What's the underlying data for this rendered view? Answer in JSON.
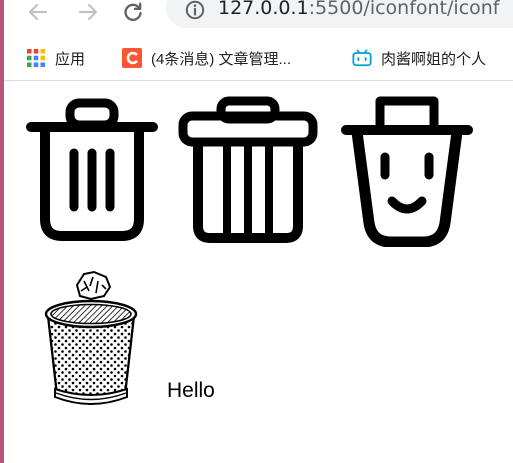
{
  "browser": {
    "url_host": "127.0.0.1",
    "url_rest": ":5500/iconfont/iconf",
    "nav": {
      "back_icon": "arrow-left-icon",
      "forward_icon": "arrow-right-icon",
      "reload_icon": "reload-icon",
      "site_info_icon": "info-icon"
    }
  },
  "bookmarks": [
    {
      "label": "应用",
      "icon": "apps-grid-icon"
    },
    {
      "label": "(4条消息) 文章管理...",
      "icon": "csdn-logo-icon"
    },
    {
      "label": "肉酱啊姐的个人",
      "icon": "bilibili-tv-icon"
    }
  ],
  "page": {
    "icons": [
      {
        "name": "trash-outline-icon"
      },
      {
        "name": "trash-bold-icon"
      },
      {
        "name": "trash-smile-icon"
      },
      {
        "name": "mesh-wastebasket-icon"
      }
    ],
    "hello_text": "Hello"
  },
  "colors": {
    "icon_stroke": "#000000",
    "page_background": "#ffffff",
    "omnibox_background": "#f1f3f4",
    "apps_red": "#ea4335",
    "apps_yellow": "#fbbc04",
    "apps_green": "#34a853",
    "apps_blue": "#4285f4",
    "csdn_orange": "#fc5531",
    "bilibili_blue": "#00a1d6",
    "window_edge": "#b8557a"
  }
}
